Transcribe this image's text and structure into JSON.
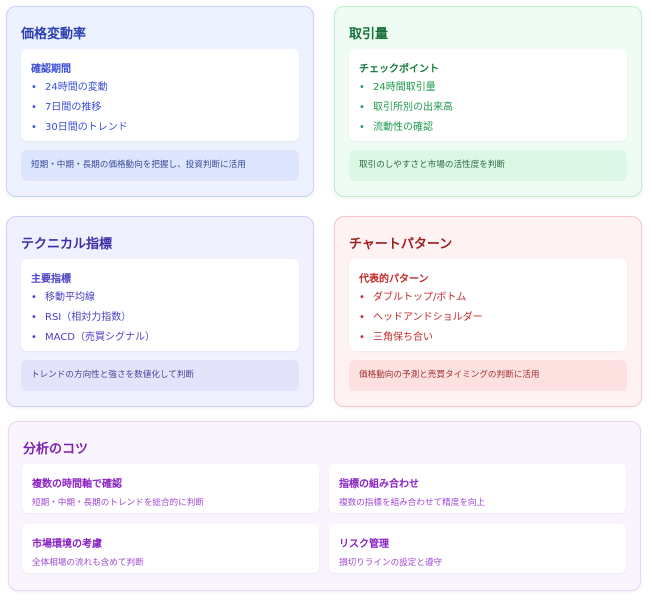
{
  "cards": [
    {
      "title": "価格変動率",
      "inner_heading": "確認期間",
      "items": [
        "24時間の変動",
        "7日間の推移",
        "30日間のトレンド"
      ],
      "note": "短期・中期・長期の価格動向を把握し、投資判断に活用"
    },
    {
      "title": "取引量",
      "inner_heading": "チェックポイント",
      "items": [
        "24時間取引量",
        "取引所別の出来高",
        "流動性の確認"
      ],
      "note": "取引のしやすさと市場の活性度を判断"
    },
    {
      "title": "テクニカル指標",
      "inner_heading": "主要指標",
      "items": [
        "移動平均線",
        "RSI（相対力指数）",
        "MACD（売買シグナル）"
      ],
      "note": "トレンドの方向性と強さを数値化して判断"
    },
    {
      "title": "チャートパターン",
      "inner_heading": "代表的パターン",
      "items": [
        "ダブルトップ/ボトム",
        "ヘッドアンドショルダー",
        "三角保ち合い"
      ],
      "note": "価格動向の予測と売買タイミングの判断に活用"
    }
  ],
  "tips": {
    "title": "分析のコツ",
    "items": [
      {
        "heading": "複数の時間軸で確認",
        "desc": "短期・中期・長期のトレンドを総合的に判断"
      },
      {
        "heading": "指標の組み合わせ",
        "desc": "複数の指標を組み合わせて精度を向上"
      },
      {
        "heading": "市場環境の考慮",
        "desc": "全体相場の流れも含めて判断"
      },
      {
        "heading": "リスク管理",
        "desc": "損切りラインの設定と遵守"
      }
    ]
  },
  "bullet": "•"
}
